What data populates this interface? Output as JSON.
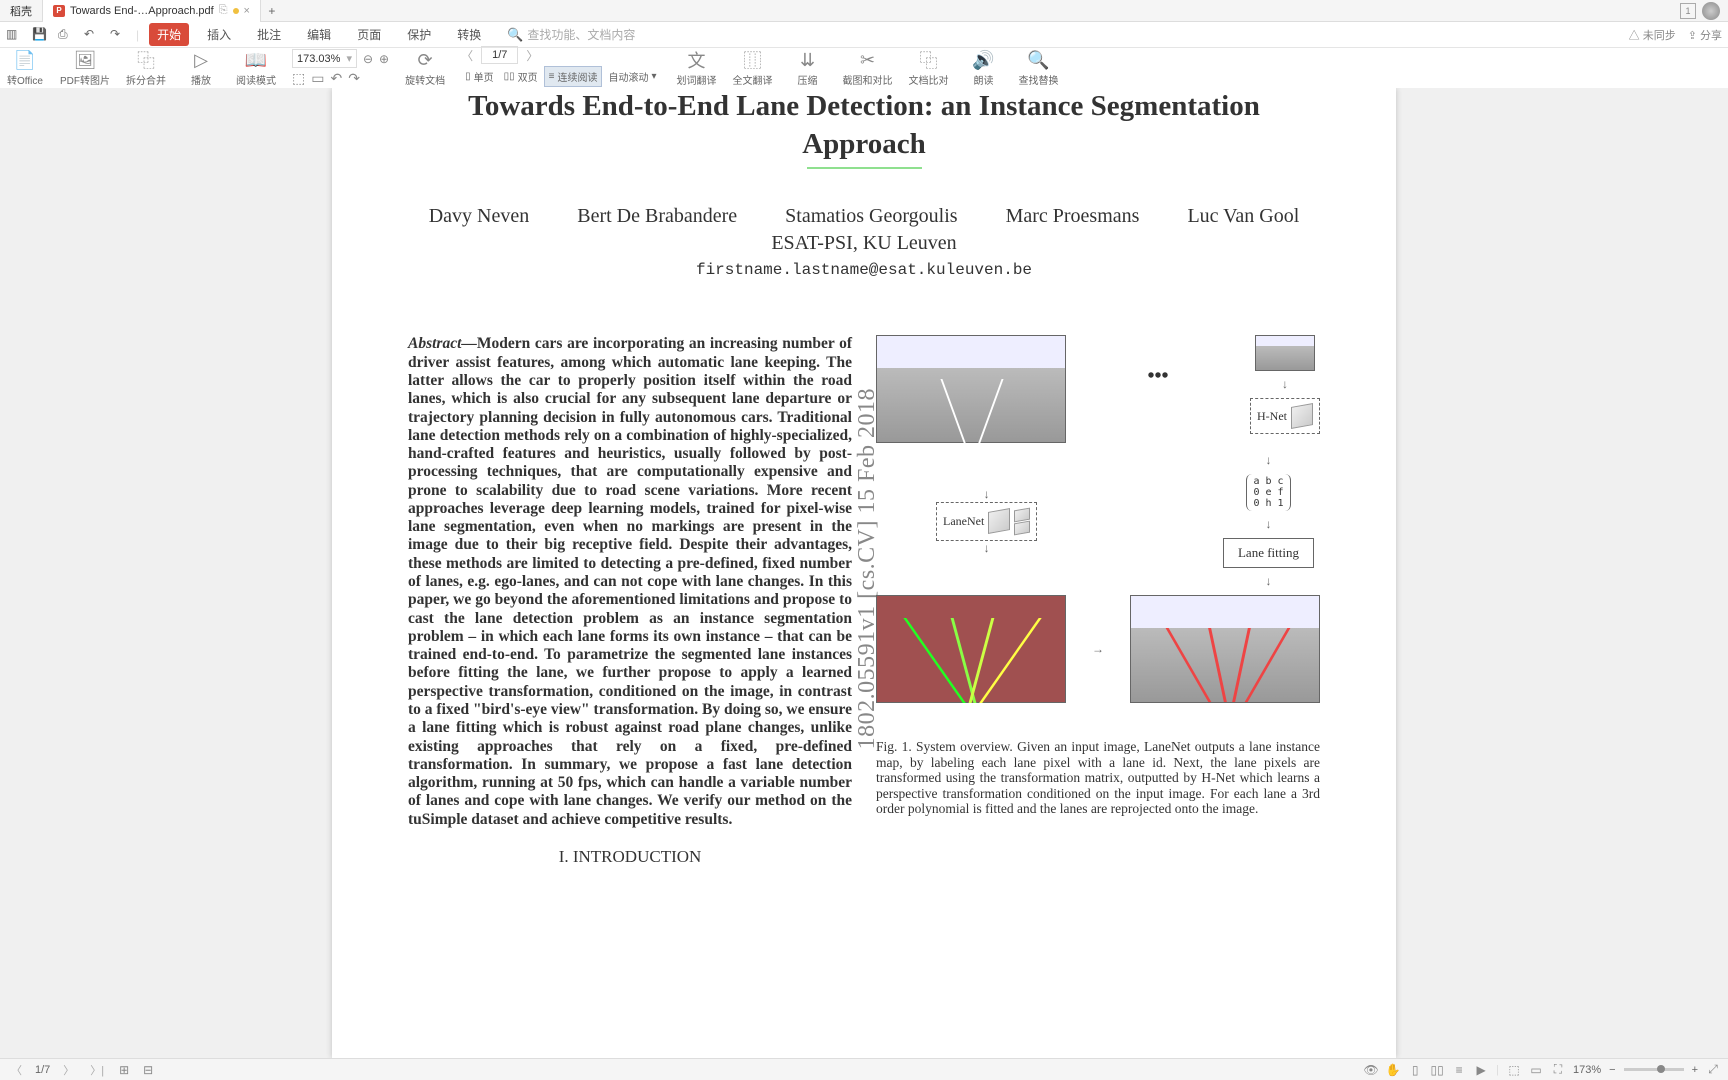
{
  "titlebar": {
    "tab1_label": "稻壳",
    "tab2_label": "Towards End-…Approach.pdf",
    "window_mode": "1"
  },
  "menubar": {
    "tabs": [
      "开始",
      "插入",
      "批注",
      "编辑",
      "页面",
      "保护",
      "转换"
    ],
    "search_placeholder": "查找功能、文档内容",
    "right": {
      "sync": "未同步",
      "share": "分享"
    }
  },
  "toolbar": {
    "items": [
      "转Office",
      "PDF转图片",
      "拆分合并",
      "播放",
      "阅读模式"
    ],
    "zoom": "173.03%",
    "page": "1/7",
    "rotate": "旋转文档",
    "view_single": "单页",
    "view_double": "双页",
    "view_cont": "连续阅读",
    "auto_scroll": "自动滚动",
    "items2": [
      "划词翻译",
      "全文翻译",
      "压缩",
      "截图和对比",
      "文档比对",
      "朗读",
      "查找替换"
    ]
  },
  "paper": {
    "title_line1": "Towards End-to-End Lane Detection: an Instance Segmentation",
    "title_line2": "Approach",
    "authors": [
      "Davy Neven",
      "Bert De Brabandere",
      "Stamatios Georgoulis",
      "Marc Proesmans",
      "Luc Van Gool"
    ],
    "affiliation": "ESAT-PSI, KU Leuven",
    "email": "firstname.lastname@esat.kuleuven.be",
    "arxiv": "1802.05591v1  [cs.CV]  15 Feb 2018",
    "abstract_lead": "Abstract—",
    "abstract": "Modern cars are incorporating an increasing number of driver assist features, among which automatic lane keeping. The latter allows the car to properly position itself within the road lanes, which is also crucial for any subsequent lane departure or trajectory planning decision in fully autonomous cars. Traditional lane detection methods rely on a combination of highly-specialized, hand-crafted features and heuristics, usually followed by post-processing techniques, that are computationally expensive and prone to scalability due to road scene variations. More recent approaches leverage deep learning models, trained for pixel-wise lane segmentation, even when no markings are present in the image due to their big receptive field. Despite their advantages, these methods are limited to detecting a pre-defined, fixed number of lanes, e.g. ego-lanes, and can not cope with lane changes. In this paper, we go beyond the aforementioned limitations and propose to cast the lane detection problem as an instance segmentation problem – in which each lane forms its own instance – that can be trained end-to-end. To parametrize the segmented lane instances before fitting the lane, we further propose to apply a learned perspective transformation, conditioned on the image, in contrast to a fixed \"bird's-eye view\" transformation. By doing so, we ensure a lane fitting which is robust against road plane changes, unlike existing approaches that rely on a fixed, pre-defined transformation. In summary, we propose a fast lane detection algorithm, running at 50 fps, which can handle a variable number of lanes and cope with lane changes. We verify our method on the tuSimple dataset and achieve competitive results.",
    "section1": "I.  INTRODUCTION",
    "fig": {
      "lanenet": "LaneNet",
      "hnet": "H-Net",
      "lanefit": "Lane fitting",
      "caption_lead": "Fig. 1.",
      "caption": "   System overview. Given an input image, LaneNet outputs a lane instance map, by labeling each lane pixel with a lane id. Next, the lane pixels are transformed using the transformation matrix, outputted by H-Net which learns a perspective transformation conditioned on the input image. For each lane a 3rd order polynomial is fitted and the lanes are reprojected onto the image."
    }
  },
  "statusbar": {
    "page": "1/7",
    "zoom": "173%"
  }
}
